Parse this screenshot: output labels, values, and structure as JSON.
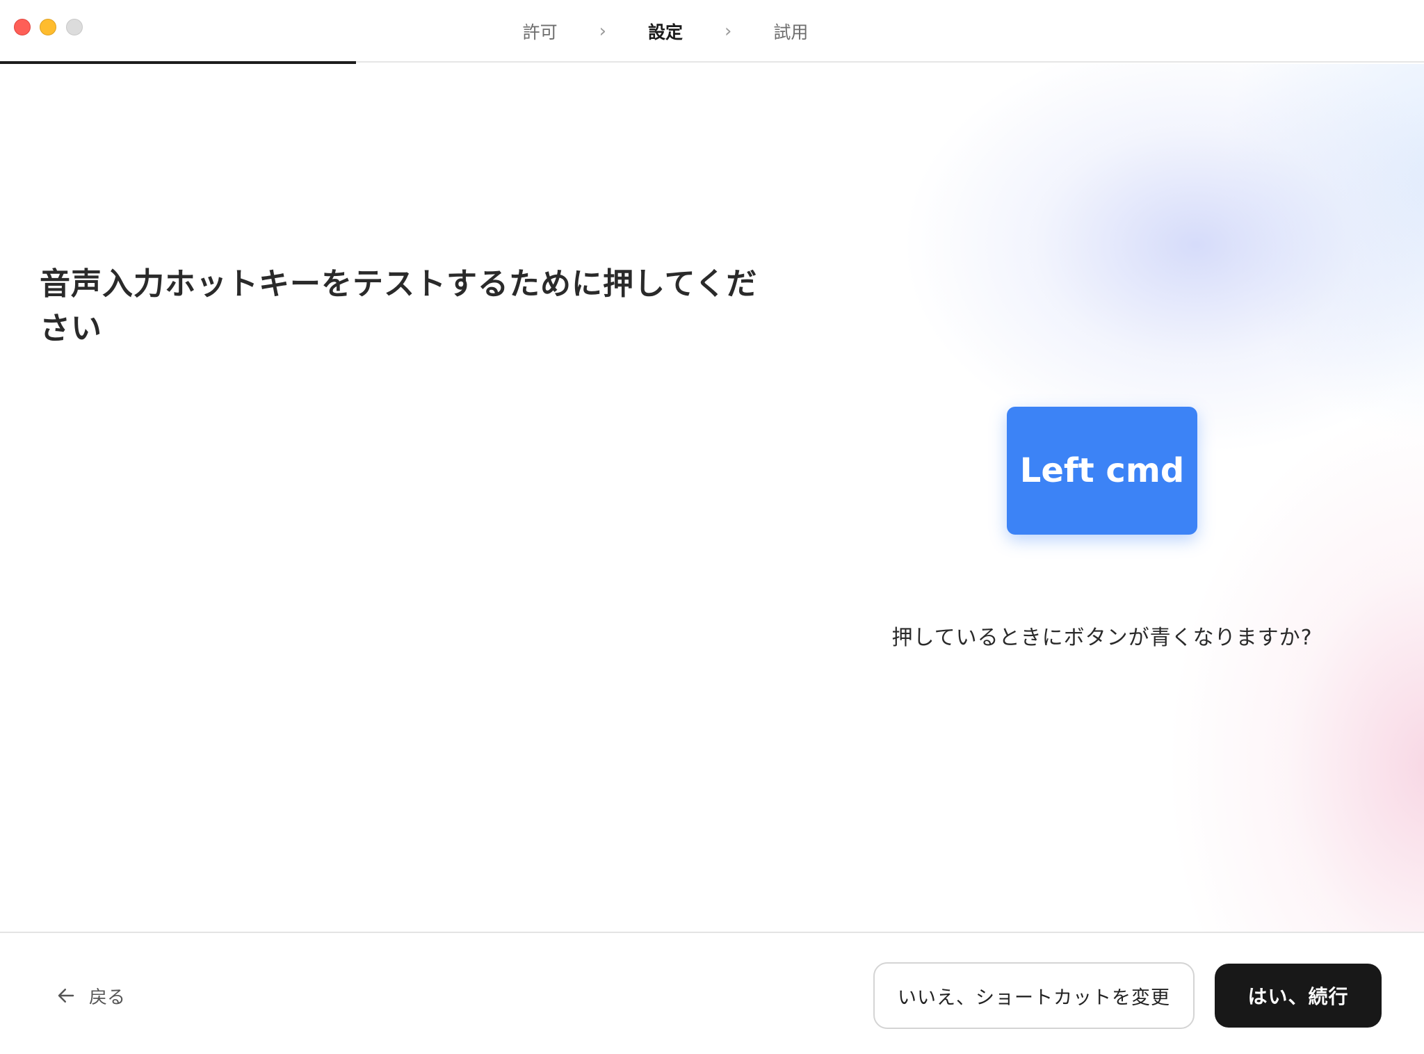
{
  "steps": [
    {
      "label": "許可",
      "active": false
    },
    {
      "label": "設定",
      "active": true
    },
    {
      "label": "試用",
      "active": false
    }
  ],
  "progress": 0.25,
  "heading": {
    "bold_part_1": "音声入力",
    "normal_part_1": "ホットキーをテストするために",
    "bold_part_2": "押",
    "normal_part_2": "してください"
  },
  "key": {
    "label": "Left cmd",
    "color": "#3c83f6"
  },
  "question": "押しているときにボタンが青くなりますか?",
  "footer": {
    "back_label": "戻る",
    "secondary_label": "いいえ、ショートカットを変更",
    "primary_label": "はい、続行"
  },
  "icons": {
    "step_separator": "chevron-right-icon",
    "back": "arrow-left-icon"
  }
}
